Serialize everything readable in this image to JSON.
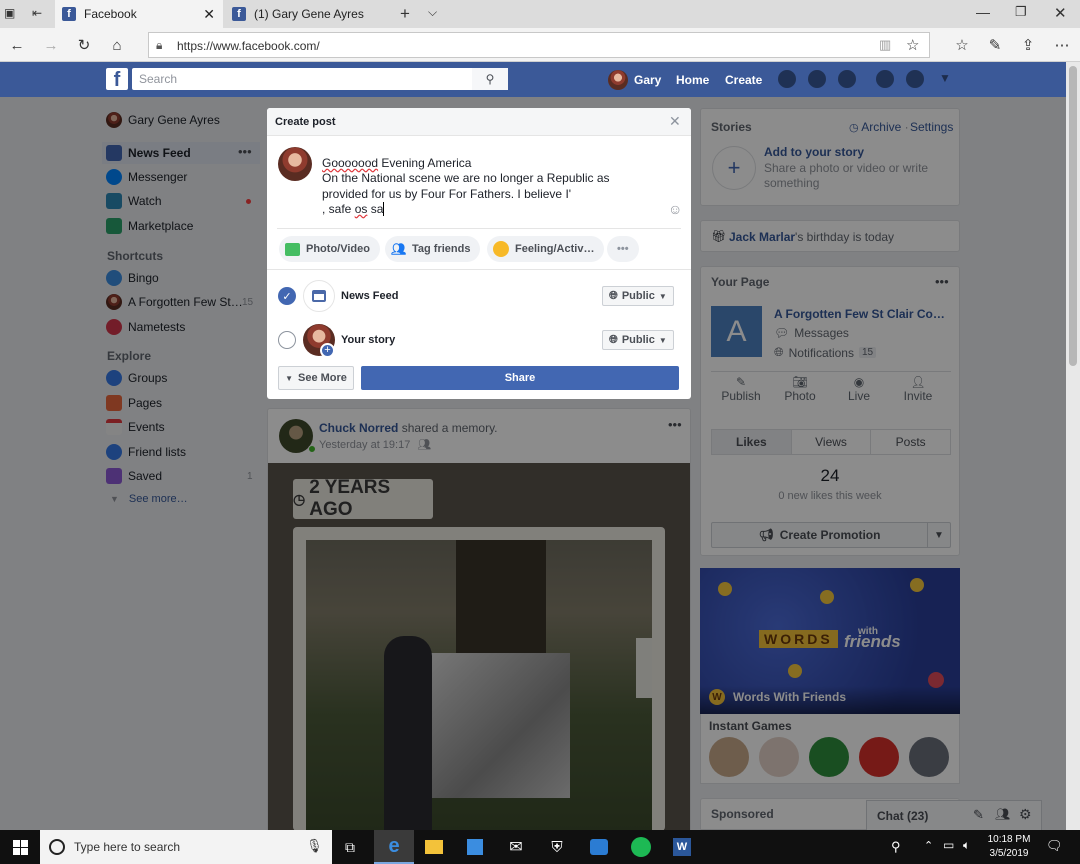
{
  "browser": {
    "tabs": [
      {
        "title": "Facebook",
        "active": true
      },
      {
        "title": "(1) Gary Gene Ayres",
        "active": false
      }
    ],
    "url": "https://www.facebook.com/"
  },
  "fb_topbar": {
    "search_placeholder": "Search",
    "user_name": "Gary",
    "home": "Home",
    "create": "Create",
    "brand_color": "#3b5998"
  },
  "left_nav": {
    "profile_name": "Gary Gene Ayres",
    "items": [
      {
        "label": "News Feed",
        "icon": "news-feed-icon"
      },
      {
        "label": "Messenger",
        "icon": "messenger-icon"
      },
      {
        "label": "Watch",
        "icon": "watch-icon"
      },
      {
        "label": "Marketplace",
        "icon": "marketplace-icon"
      }
    ],
    "shortcuts_heading": "Shortcuts",
    "shortcuts": [
      {
        "label": "Bingo",
        "count": ""
      },
      {
        "label": "A Forgotten Few St…",
        "count": "15"
      },
      {
        "label": "Nametests",
        "count": ""
      }
    ],
    "explore_heading": "Explore",
    "explore": [
      {
        "label": "Groups",
        "count": ""
      },
      {
        "label": "Pages",
        "count": ""
      },
      {
        "label": "Events",
        "count": ""
      },
      {
        "label": "Friend lists",
        "count": ""
      },
      {
        "label": "Saved",
        "count": "1"
      }
    ],
    "see_more": "See more…"
  },
  "modal": {
    "title": "Create post",
    "post_text_lines": [
      "Gooooood Evening America",
      "On the National scene we are no longer a Republic as",
      "provided for us by Four For Fathers.  I believe I'",
      ", safe os sa"
    ],
    "actions": [
      "Photo/Video",
      "Tag friends",
      "Feeling/Activ…"
    ],
    "targets": [
      {
        "label": "News Feed",
        "privacy": "Public",
        "checked": true
      },
      {
        "label": "Your story",
        "privacy": "Public",
        "checked": false
      }
    ],
    "see_more": "See More",
    "share": "Share"
  },
  "feed_post": {
    "author": "Chuck Norred",
    "action": "shared a memory.",
    "time": "Yesterday at 19:17",
    "memory_label": "2 YEARS AGO"
  },
  "right": {
    "stories": {
      "title": "Stories",
      "archive": "Archive",
      "settings": "Settings",
      "add_title": "Add to your story",
      "add_sub": "Share a photo or video or write something"
    },
    "birthday": {
      "name": "Jack Marlar",
      "text": "'s birthday is today"
    },
    "your_page": {
      "title": "Your Page",
      "page_name": "A Forgotten Few St Clair Co…",
      "avatar_letter": "A",
      "messages": "Messages",
      "notifications": "Notifications",
      "notifications_count": "15",
      "actions": [
        "Publish",
        "Photo",
        "Live",
        "Invite"
      ],
      "tabs": [
        "Likes",
        "Views",
        "Posts"
      ],
      "likes_count": "24",
      "likes_sub": "0 new likes this week",
      "promotion": "Create Promotion"
    },
    "game": {
      "title": "Words With Friends",
      "logo_words": "WORDS",
      "logo_friends": "friends",
      "logo_with": "with"
    },
    "instant_games": "Instant Games",
    "sponsored": "Sponsored",
    "chat": "Chat (23)"
  },
  "taskbar": {
    "search_placeholder": "Type here to search",
    "time": "10:18 PM",
    "date": "3/5/2019"
  }
}
